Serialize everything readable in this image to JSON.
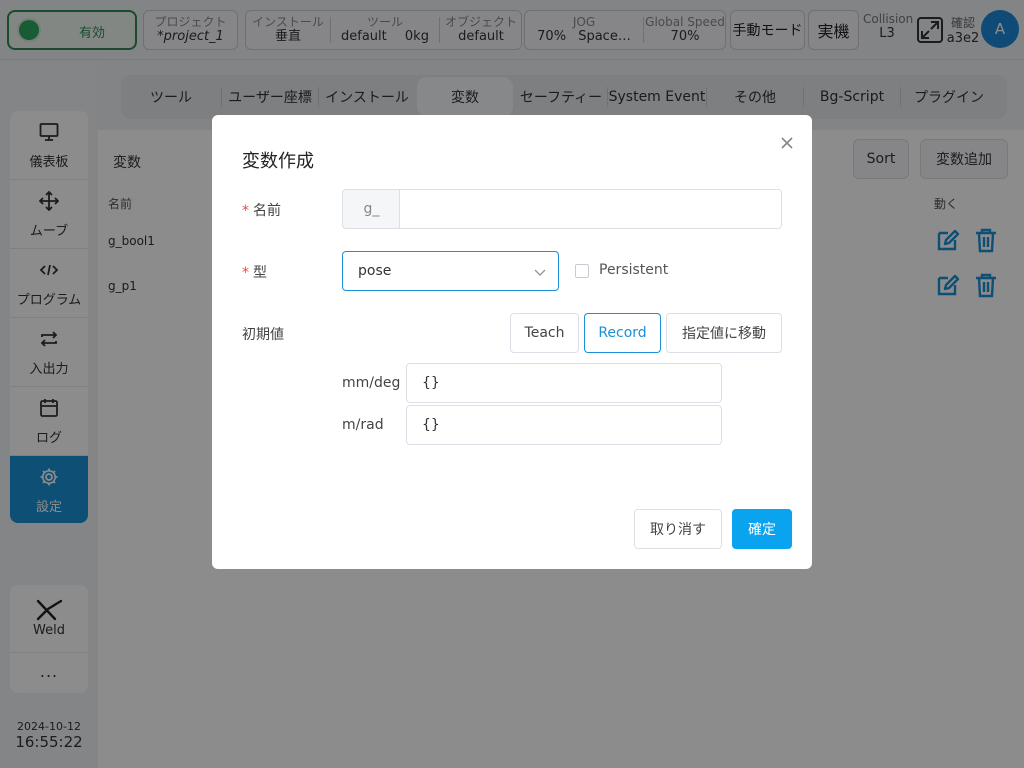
{
  "topbar": {
    "enable_label": "有効",
    "project": {
      "label": "プロジェクト",
      "value": "*project_1"
    },
    "install": {
      "label": "インストール",
      "value": "垂直"
    },
    "tool": {
      "label": "ツール",
      "value": "default",
      "weight": "0kg"
    },
    "object": {
      "label": "オブジェクト",
      "value": "default"
    },
    "jog": {
      "label": "JOG",
      "value": "70%",
      "space": "Space…"
    },
    "global_speed": {
      "label": "Global Speed",
      "value": "70%"
    },
    "manual_mode": "手動モード",
    "real_machine": "実機",
    "collision": {
      "label": "Collision",
      "value": "L3"
    },
    "confirm": {
      "label": "確認",
      "value": "a3e2"
    },
    "avatar": "A"
  },
  "sidebar": {
    "items": [
      {
        "label": "儀表板",
        "icon": "monitor-icon"
      },
      {
        "label": "ムーブ",
        "icon": "move-icon"
      },
      {
        "label": "プログラム",
        "icon": "code-icon"
      },
      {
        "label": "入出力",
        "icon": "io-arrows-icon"
      },
      {
        "label": "ログ",
        "icon": "calendar-icon"
      },
      {
        "label": "設定",
        "icon": "gear-icon"
      }
    ],
    "weld_label": "Weld",
    "more_label": "...",
    "date": "2024-10-12",
    "time": "16:55:22"
  },
  "tabs": [
    "ツール",
    "ユーザー座標",
    "インストール",
    "変数",
    "セーフティー",
    "System Event",
    "その他",
    "Bg-Script",
    "プラグイン"
  ],
  "variables": {
    "title": "変数",
    "sort_label": "Sort",
    "add_label": "変数追加",
    "col_name": "名前",
    "col_action": "動く",
    "rows": [
      "g_bool1",
      "g_p1"
    ]
  },
  "dialog": {
    "title": "変数作成",
    "name_label": "名前",
    "name_prefix": "g_",
    "name_value": "",
    "type_label": "型",
    "type_value": "pose",
    "persistent_label": "Persistent",
    "initial_label": "初期値",
    "teach_label": "Teach",
    "record_label": "Record",
    "move_label": "指定値に移動",
    "mmdeg_label": "mm/deg",
    "mmdeg_value": "{}",
    "mrad_label": "m/rad",
    "mrad_value": "{}",
    "cancel_label": "取り消す",
    "ok_label": "確定"
  },
  "colors": {
    "accent": "#1a90d8",
    "primary_button": "#0aa3f0",
    "enable_green": "#2e8b57",
    "required_star": "#e74c3c"
  }
}
